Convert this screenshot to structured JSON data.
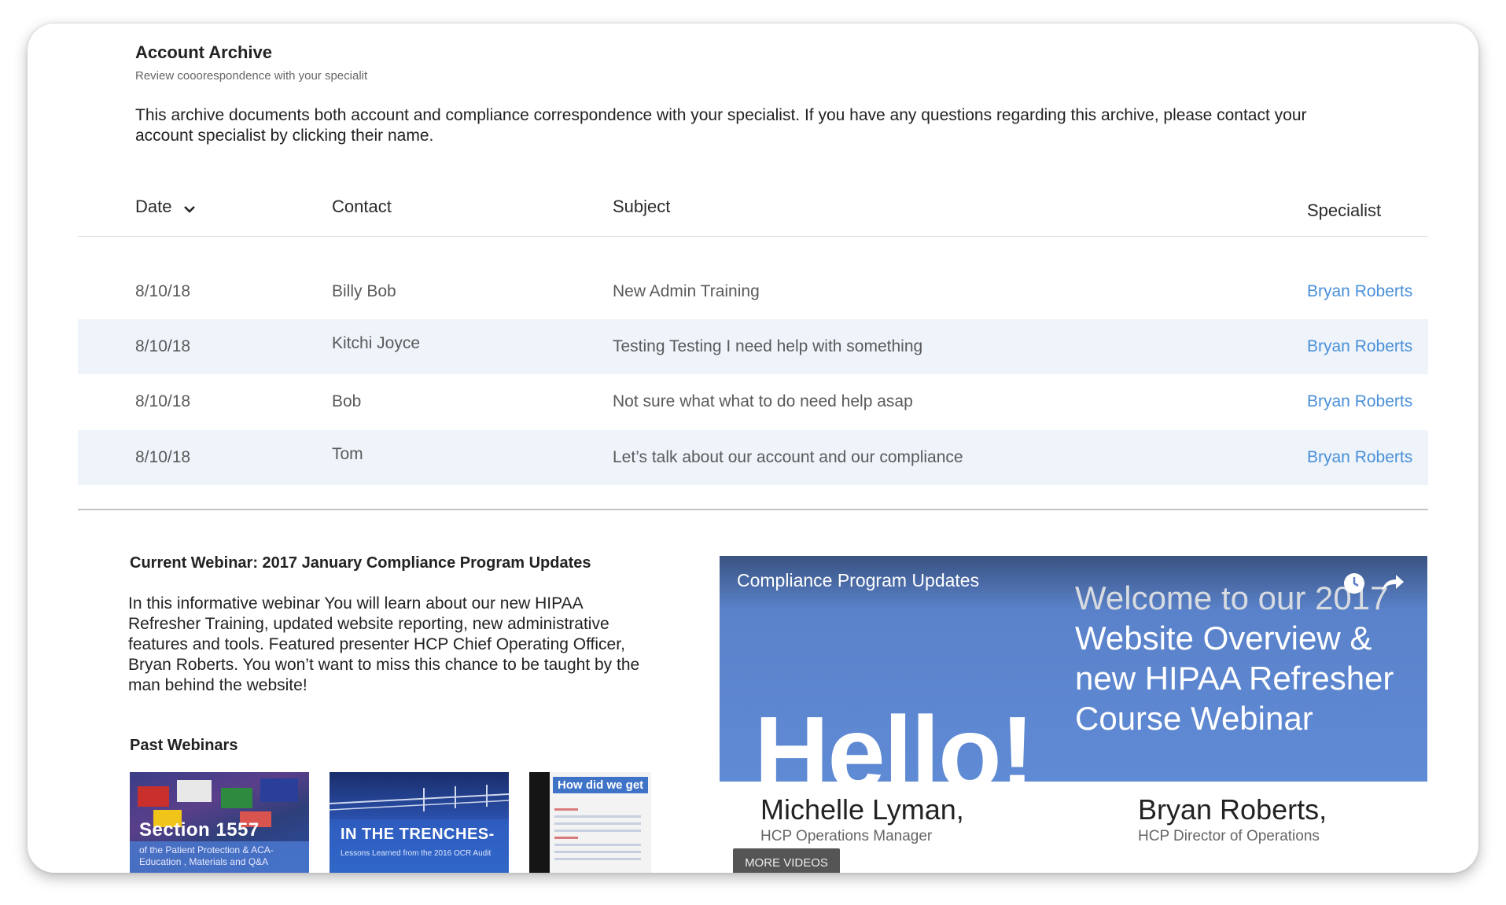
{
  "header": {
    "title": "Account Archive",
    "subtitle": "Review cooorespondence with your specialit",
    "intro": "This archive documents both account and compliance correspondence with your specialist.  If you have any questions regarding this archive, please contact your account specialist by clicking their name."
  },
  "table": {
    "columns": {
      "date": "Date",
      "contact": "Contact",
      "subject": "Subject",
      "specialist": "Specialist"
    },
    "sort_icon": "chevron-down-icon",
    "rows": [
      {
        "date": "8/10/18",
        "contact": "Billy Bob",
        "subject": "New Admin Training",
        "specialist": "Bryan Roberts"
      },
      {
        "date": "8/10/18",
        "contact": "Kitchi Joyce",
        "subject": "Testing Testing I need help with something",
        "specialist": "Bryan Roberts"
      },
      {
        "date": "8/10/18",
        "contact": "Bob",
        "subject": "Not sure what what  to do need help asap",
        "specialist": "Bryan Roberts"
      },
      {
        "date": "8/10/18",
        "contact": "Tom",
        "subject": "Let’s talk about our account and our compliance",
        "specialist": "Bryan Roberts"
      }
    ]
  },
  "webinar": {
    "current_title": "Current Webinar: 2017 January Compliance Program Updates",
    "description": "In this informative webinar You will learn about our new HIPAA Refresher Training, updated website reporting, new administrative features and tools. Featured presenter HCP Chief Operating Officer, Bryan Roberts. You won’t want to miss this chance to be taught by the man behind the website!",
    "past_title": "Past Webinars",
    "thumbnails": [
      {
        "title": "Section 1557",
        "subtitle": "of the Patient Protection & ACA- Education , Materials and Q&A"
      },
      {
        "title": "IN THE TRENCHES-",
        "subtitle": "Lessons Learned from the 2016 OCR Audit"
      },
      {
        "title": "How did we get"
      }
    ],
    "video": {
      "title": "Compliance Program Updates",
      "welcome_line1": "Welcome to our 2017",
      "welcome_rest": "Website Overview & new HIPAA Refresher Course Webinar",
      "hello": "Hello!",
      "presenter1_name": "Michelle Lyman,",
      "presenter1_role": "HCP Operations Manager",
      "presenter2_name": "Bryan Roberts,",
      "presenter2_role": "HCP Director of Operations",
      "more_videos": "MORE VIDEOS",
      "icons": [
        "clock-icon",
        "share-icon"
      ]
    }
  },
  "colors": {
    "link": "#4a90d9",
    "row_alt": "#eef4fa",
    "video_blue": "#5f8ad4"
  }
}
